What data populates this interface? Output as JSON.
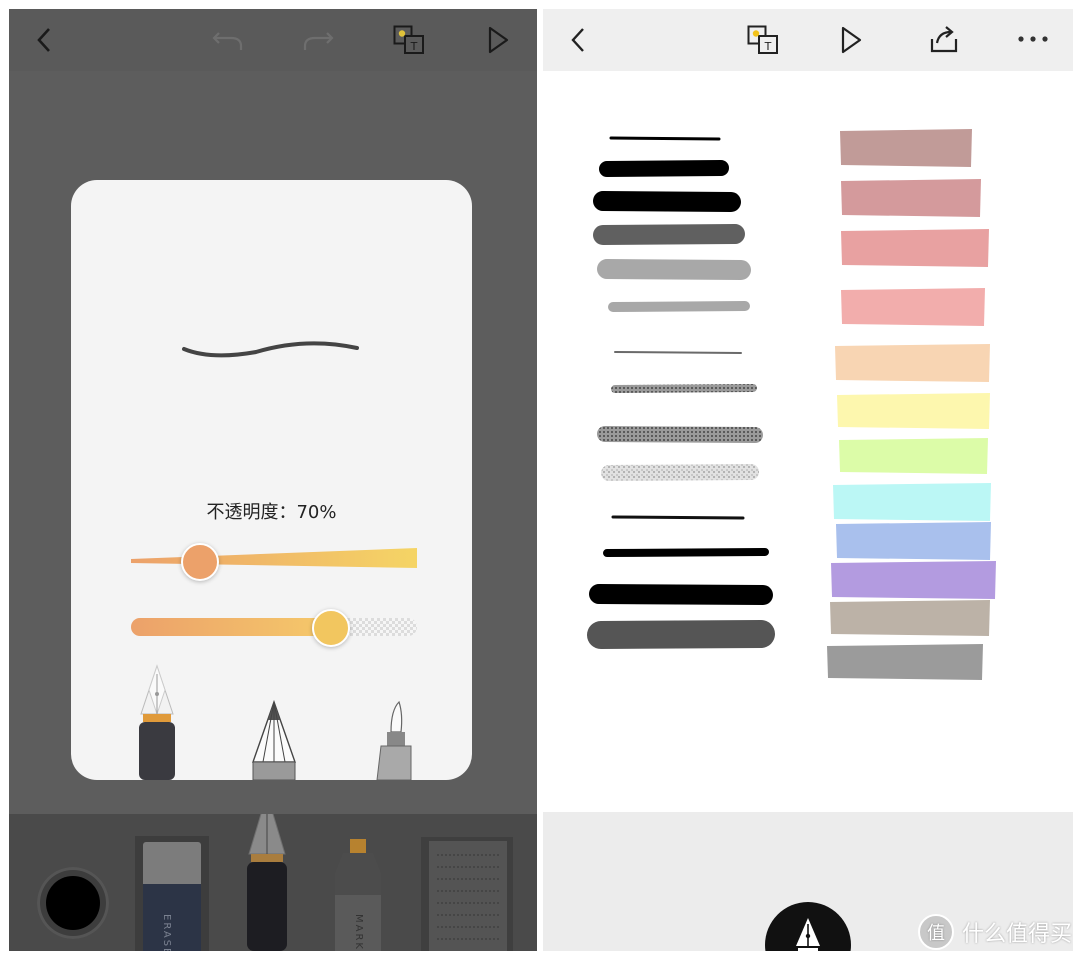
{
  "left_screen": {
    "toolbar": {
      "back_icon": "chevron-left-icon",
      "undo_icon": "undo-icon",
      "redo_icon": "redo-icon",
      "translate_icon": "translate-icon",
      "play_icon": "play-icon"
    },
    "brush_popup": {
      "preview_icon": "stroke-preview",
      "opacity_label": "不透明度：70%",
      "opacity_percent": 70,
      "size_slider_level": 0.24,
      "opacity_slider_level": 0.7,
      "tools": [
        "fountain-pen-icon",
        "pencil-icon",
        "brush-pen-icon"
      ]
    },
    "bottom_tools": {
      "current_color": "#000000",
      "eraser_text": "ERASE",
      "marker_text": "MARK",
      "tools": [
        "color-well",
        "eraser-icon",
        "fountain-pen-icon",
        "marker-icon",
        "paper-icon"
      ]
    }
  },
  "right_screen": {
    "toolbar": {
      "back_icon": "chevron-left-icon",
      "translate_icon": "translate-icon",
      "play_icon": "play-icon",
      "share_icon": "share-icon",
      "more_icon": "more-icon"
    },
    "ink_stroke_colors": [
      "#000000",
      "#000000",
      "#000000",
      "#606060",
      "#a8a8a8",
      "#a8a8a8",
      "#6a6a6a",
      "#808080",
      "#6e6e6e",
      "#c4c4c4",
      "#111111",
      "#000000",
      "#000000",
      "#555555"
    ],
    "highlighter_colors": [
      "#c19b98",
      "#d49a9c",
      "#e8a1a1",
      "#f2adac",
      "#f8d5b3",
      "#fdf7ae",
      "#dcfca8",
      "#bbf7f5",
      "#a9c0ed",
      "#b39be0",
      "#bcb2a7",
      "#9b9b9b"
    ],
    "pen_button_icon": "fountain-pen-icon"
  },
  "watermark": {
    "logo_text": "值",
    "text": "什么值得买"
  }
}
